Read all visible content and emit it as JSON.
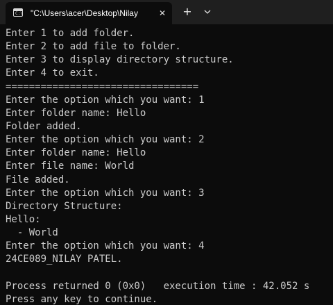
{
  "window": {
    "tab_title": "\"C:\\Users\\acer\\Desktop\\Nilay",
    "tab_close_glyph": "✕",
    "new_tab_glyph": "+",
    "icon_prompt_text": "C:\\"
  },
  "console": {
    "lines": [
      "Enter 1 to add folder.",
      "Enter 2 to add file to folder.",
      "Enter 3 to display directory structure.",
      "Enter 4 to exit.",
      "=================================",
      "Enter the option which you want: 1",
      "Enter folder name: Hello",
      "Folder added.",
      "Enter the option which you want: 2",
      "Enter folder name: Hello",
      "Enter file name: World",
      "File added.",
      "Enter the option which you want: 3",
      "Directory Structure:",
      "Hello:",
      "  - World",
      "Enter the option which you want: 4",
      "24CE089_NILAY PATEL.",
      "",
      "Process returned 0 (0x0)   execution time : 42.052 s",
      "Press any key to continue."
    ]
  },
  "colors": {
    "background": "#0c0c0c",
    "titlebar": "#1f1f1f",
    "text": "#cccccc"
  }
}
